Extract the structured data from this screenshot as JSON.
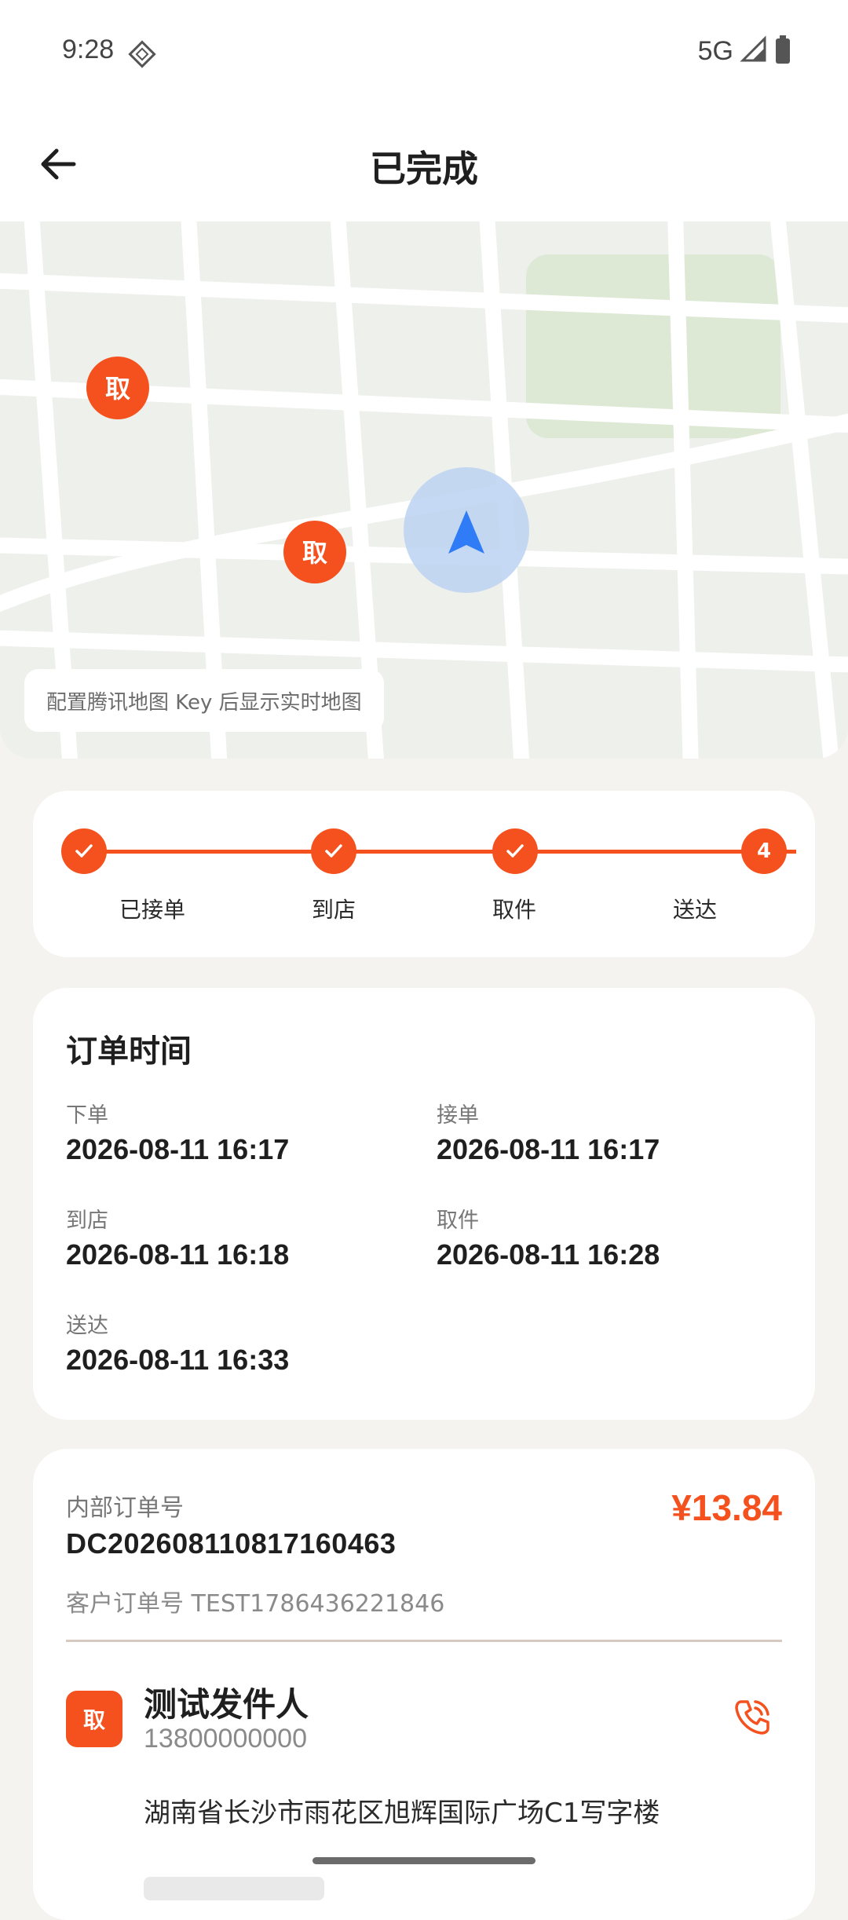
{
  "status_bar": {
    "time": "9:28",
    "network": "5G"
  },
  "header": {
    "title": "已完成"
  },
  "map": {
    "markers": [
      {
        "label": "取"
      },
      {
        "label": "取"
      }
    ],
    "notice": "配置腾讯地图 Key 后显示实时地图"
  },
  "progress": {
    "steps": [
      {
        "label": "已接单",
        "state": "done"
      },
      {
        "label": "到店",
        "state": "done"
      },
      {
        "label": "取件",
        "state": "done"
      },
      {
        "label": "送达",
        "state": "current",
        "number": "4"
      }
    ]
  },
  "order_time": {
    "title": "订单时间",
    "items": [
      {
        "label": "下单",
        "value": "2026-08-11 16:17"
      },
      {
        "label": "接单",
        "value": "2026-08-11 16:17"
      },
      {
        "label": "到店",
        "value": "2026-08-11 16:18"
      },
      {
        "label": "取件",
        "value": "2026-08-11 16:28"
      },
      {
        "label": "送达",
        "value": "2026-08-11 16:33"
      }
    ]
  },
  "order_info": {
    "internal_label": "内部订单号",
    "internal_number": "DC202608110817160463",
    "price": "¥13.84",
    "customer_order": "客户订单号 TEST1786436221846",
    "sender": {
      "badge": "取",
      "name": "测试发件人",
      "phone": "13800000000",
      "address": "湖南省长沙市雨花区旭辉国际广场C1写字楼"
    }
  },
  "colors": {
    "accent": "#f4511e",
    "nav_arrow": "#2f7cf6"
  }
}
